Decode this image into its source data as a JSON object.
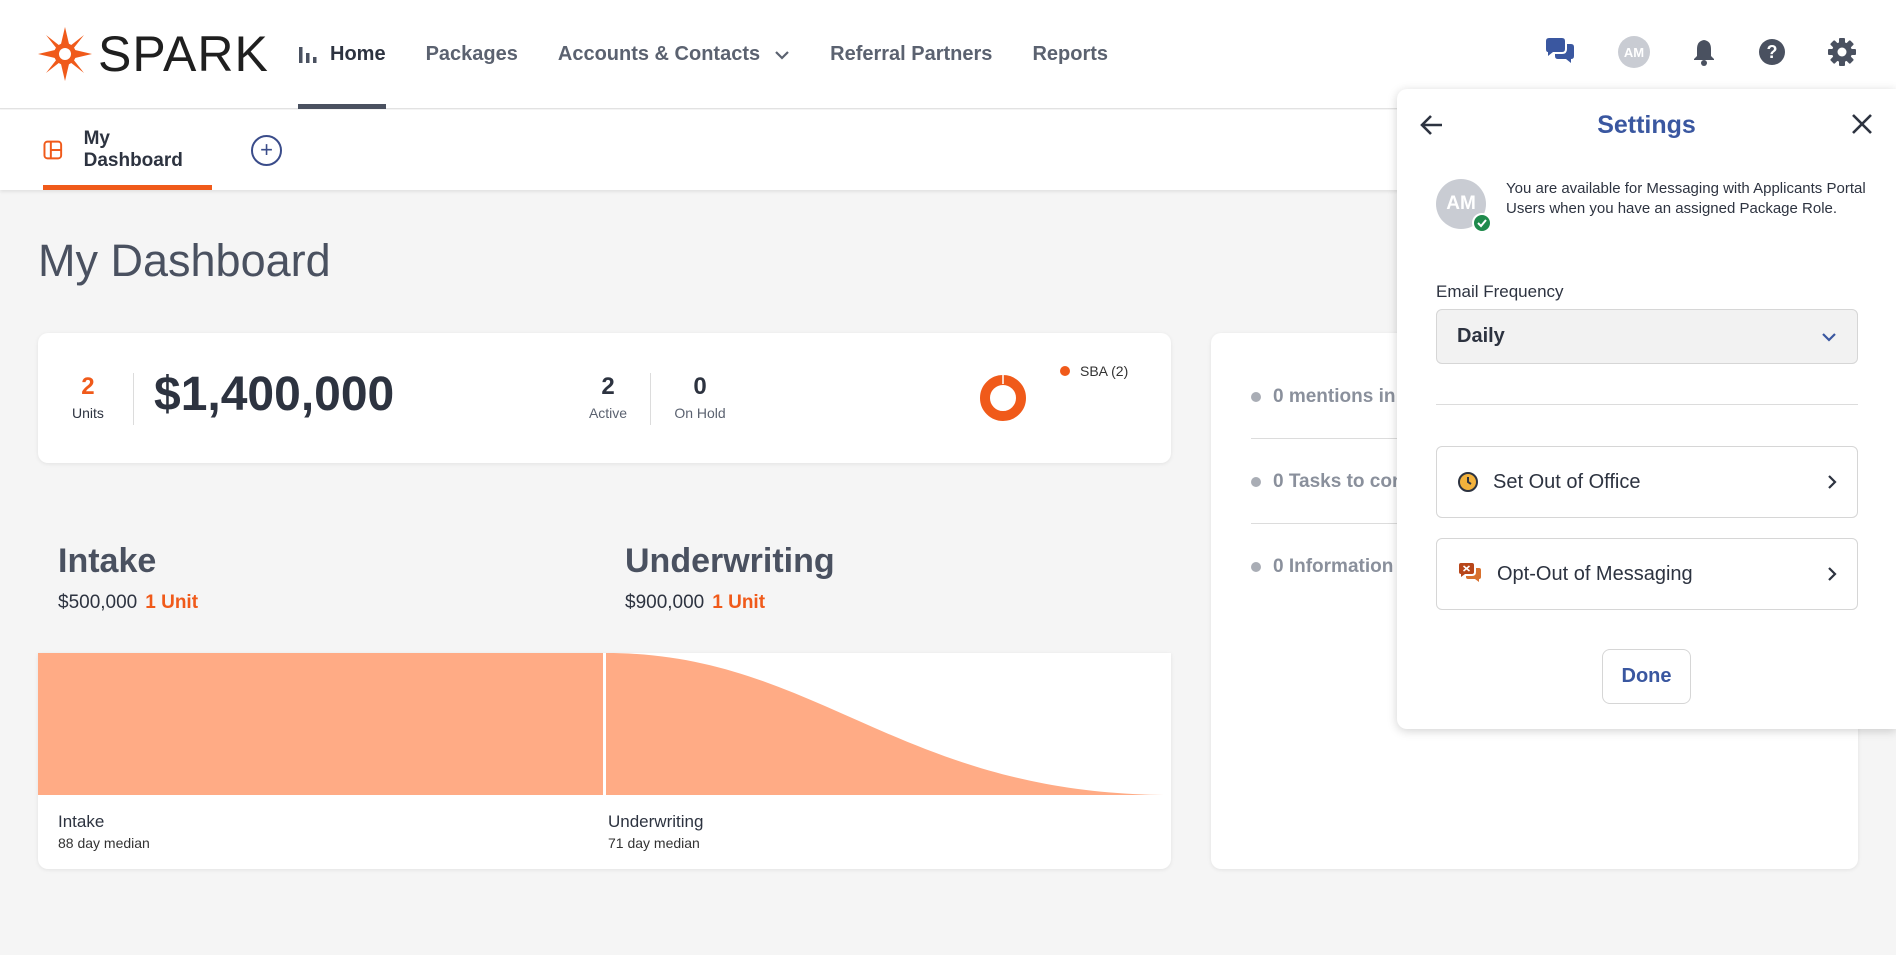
{
  "app": {
    "logo_text": "SPARK"
  },
  "nav": {
    "items": [
      {
        "label": "Home"
      },
      {
        "label": "Packages"
      },
      {
        "label": "Accounts & Contacts"
      },
      {
        "label": "Referral Partners"
      },
      {
        "label": "Reports"
      }
    ],
    "avatar_initials": "AM"
  },
  "tabs": {
    "active_label": "My Dashboard",
    "add_symbol": "+"
  },
  "page": {
    "title": "My Dashboard"
  },
  "summary": {
    "units_value": "2",
    "units_label": "Units",
    "total_amount": "$1,400,000",
    "active_value": "2",
    "active_label": "Active",
    "onhold_value": "0",
    "onhold_label": "On Hold",
    "legend_label": "SBA (2)"
  },
  "stages": [
    {
      "title": "Intake",
      "amount": "$500,000",
      "units": "1 Unit",
      "label": "Intake",
      "median": "88 day median"
    },
    {
      "title": "Underwriting",
      "amount": "$900,000",
      "units": "1 Unit",
      "label": "Underwriting",
      "median": "71 day median"
    }
  ],
  "todos": [
    {
      "text": "0 mentions in"
    },
    {
      "text": "0 Tasks to con"
    },
    {
      "text": "0 Information"
    }
  ],
  "settings": {
    "title": "Settings",
    "avatar_initials": "AM",
    "availability_text": "You are available for Messaging with Applicants Portal Users when you have an assigned Package Role.",
    "email_frequency_label": "Email Frequency",
    "email_frequency_value": "Daily",
    "out_of_office_label": "Set Out of Office",
    "opt_out_label": "Opt-Out of Messaging",
    "done_label": "Done"
  },
  "colors": {
    "brand_orange": "#f05a1a",
    "accent_blue": "#3a57a0",
    "funnel_fill": "#ffab85"
  }
}
